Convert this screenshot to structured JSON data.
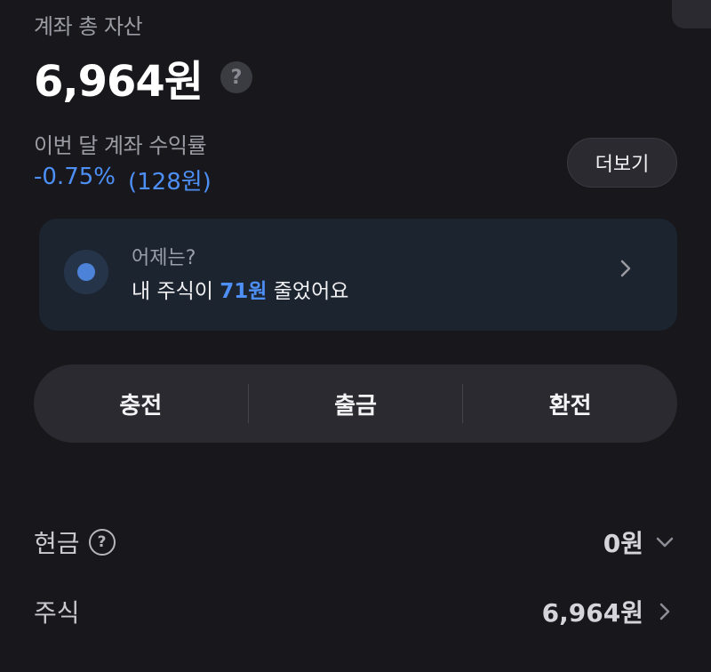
{
  "account": {
    "total_label": "계좌 총 자산",
    "total_value": "6,964원",
    "help_glyph": "?"
  },
  "returns": {
    "label": "이번 달 계좌 수익률",
    "percent": "-0.75%",
    "amount": "(128원)",
    "more_label": "더보기",
    "color": "#4d8ff5"
  },
  "yesterday": {
    "title": "어제는?",
    "prefix": "내 주식이",
    "amount": "71원",
    "suffix": "줄었어요",
    "icon": "record-dot-icon"
  },
  "actions": [
    {
      "label": "충전"
    },
    {
      "label": "출금"
    },
    {
      "label": "환전"
    }
  ],
  "assets": [
    {
      "name": "현금",
      "value": "0원",
      "icon": "chevron-down-icon"
    },
    {
      "name": "주식",
      "value": "6,964원",
      "icon": "chevron-right-icon"
    }
  ]
}
